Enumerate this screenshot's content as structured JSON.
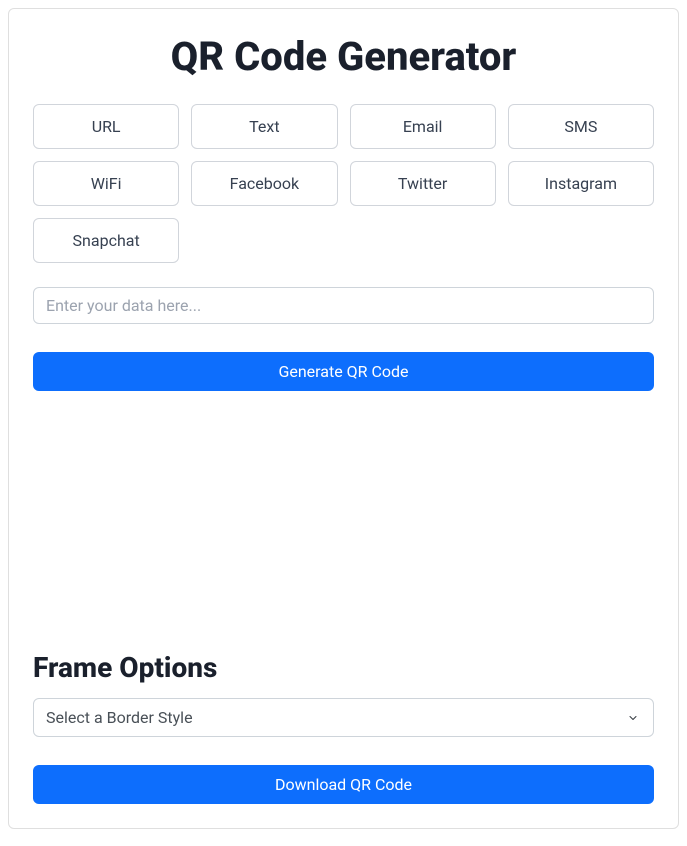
{
  "title": "QR Code Generator",
  "types": [
    {
      "label": "URL"
    },
    {
      "label": "Text"
    },
    {
      "label": "Email"
    },
    {
      "label": "SMS"
    },
    {
      "label": "WiFi"
    },
    {
      "label": "Facebook"
    },
    {
      "label": "Twitter"
    },
    {
      "label": "Instagram"
    },
    {
      "label": "Snapchat"
    }
  ],
  "input": {
    "placeholder": "Enter your data here...",
    "value": ""
  },
  "generate_label": "Generate QR Code",
  "frame": {
    "heading": "Frame Options",
    "select_placeholder": "Select a Border Style"
  },
  "download_label": "Download QR Code"
}
